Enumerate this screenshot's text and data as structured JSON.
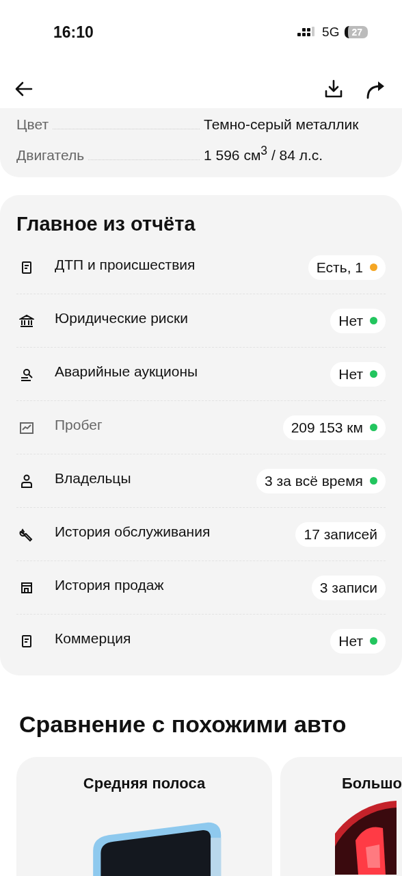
{
  "status_bar": {
    "time": "16:10",
    "network": "5G",
    "battery": "27"
  },
  "specs": [
    {
      "label": "Цвет",
      "value": "Темно-серый металлик"
    },
    {
      "label": "Двигатель",
      "value": "1 596 см$^{3}$ / 84 л.с."
    }
  ],
  "report": {
    "title": "Главное из отчёта",
    "items": [
      {
        "label": "ДТП и происшествия",
        "muted": false,
        "value": "Есть, 1",
        "color": "#f5a623"
      },
      {
        "label": "Юридические риски",
        "muted": false,
        "value": "Нет",
        "color": "#22c55e"
      },
      {
        "label": "Аварийные аукционы",
        "muted": false,
        "value": "Нет",
        "color": "#22c55e"
      },
      {
        "label": "Пробег",
        "muted": true,
        "value": "209 153 км",
        "color": "#22c55e"
      },
      {
        "label": "Владельцы",
        "muted": false,
        "value": "3 за всё время",
        "color": "#22c55e"
      },
      {
        "label": "История обслуживания",
        "muted": false,
        "value": "17 записей"
      },
      {
        "label": "История продаж",
        "muted": false,
        "value": "3 записи"
      },
      {
        "label": "Коммерция",
        "muted": false,
        "value": "Нет",
        "color": "#22c55e"
      }
    ]
  },
  "comparison": {
    "title": "Сравнение с похожими авто",
    "cards": [
      {
        "title": "Средняя полоса",
        "kind": "picture"
      },
      {
        "title": "Большо",
        "kind": "picture"
      }
    ]
  }
}
